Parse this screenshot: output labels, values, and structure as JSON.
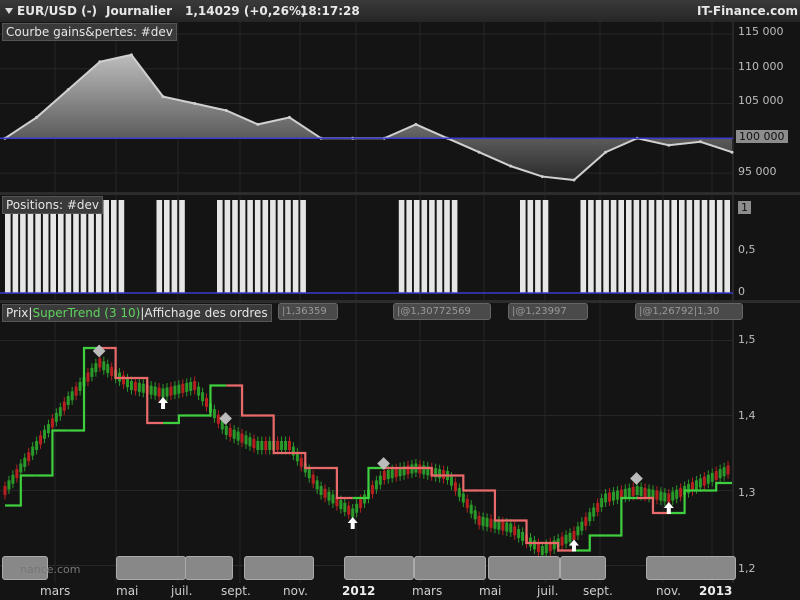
{
  "header": {
    "symbol": "EUR/USD (-)",
    "period": "Journalier",
    "price": "1,14029 (+0,26%)",
    "time": "18:17:28",
    "brand": "IT-Finance.com"
  },
  "panel1": {
    "title": "Courbe gains&pertes: #dev",
    "y_labels": [
      "115 000",
      "110 000",
      "105 000",
      "100 000",
      "95 000"
    ]
  },
  "panel2": {
    "title": "Positions: #dev",
    "y_labels": [
      "1",
      "0,5",
      "0"
    ]
  },
  "panel3": {
    "title_prefix": "Prix",
    "title_indicator": "SuperTrend (3 10)",
    "title_suffix": "Affichage des ordres",
    "order_tags": [
      "|1,36359",
      "|@1,30772569",
      "|@1,23997",
      "|@1,26792|1,30"
    ],
    "y_labels": [
      "1,5",
      "1,4",
      "1,3",
      "1,2"
    ],
    "watermark": "nance.com"
  },
  "x_axis": [
    "mars",
    "mai",
    "juil.",
    "sept.",
    "nov.",
    "2012",
    "mars",
    "mai",
    "juil.",
    "sept.",
    "nov.",
    "2013"
  ],
  "colors": {
    "equity_fill": "#9a9a9a",
    "equity_line": "#d0d0d0",
    "baseline": "#3a3ad0",
    "supertrend_up": "#3fcf3f",
    "supertrend_down": "#e86a6a",
    "candle_up": "#2a9a2a",
    "candle_down": "#b82020"
  },
  "chart_data": [
    {
      "type": "area",
      "title": "Courbe gains&pertes: #dev",
      "x": [
        "2011-02",
        "2011-03",
        "2011-04",
        "2011-05",
        "2011-06",
        "2011-07",
        "2011-08",
        "2011-09",
        "2011-10",
        "2011-11",
        "2011-12",
        "2012-01",
        "2012-02",
        "2012-03",
        "2012-04",
        "2012-05",
        "2012-06",
        "2012-07",
        "2012-08",
        "2012-09",
        "2012-10",
        "2012-11",
        "2012-12",
        "2013-01"
      ],
      "values": [
        100000,
        103000,
        107000,
        111000,
        112000,
        106000,
        105000,
        104000,
        102000,
        103000,
        100000,
        100000,
        100000,
        102000,
        100000,
        98000,
        96000,
        94500,
        94000,
        98000,
        100000,
        99000,
        99500,
        98000
      ],
      "ylim": [
        93000,
        116000
      ],
      "baseline": 100000
    },
    {
      "type": "bar",
      "title": "Positions: #dev",
      "x": [
        "2011-02",
        "2011-03",
        "2011-04",
        "2011-05",
        "2011-06",
        "2011-07",
        "2011-08",
        "2011-09",
        "2011-10",
        "2011-11",
        "2011-12",
        "2012-01",
        "2012-02",
        "2012-03",
        "2012-04",
        "2012-05",
        "2012-06",
        "2012-07",
        "2012-08",
        "2012-09",
        "2012-10",
        "2012-11",
        "2012-12",
        "2013-01"
      ],
      "values": [
        1,
        1,
        1,
        1,
        0,
        1,
        0,
        1,
        1,
        1,
        0,
        0,
        0,
        1,
        1,
        0,
        0,
        1,
        0,
        1,
        1,
        1,
        1,
        1
      ],
      "ylim": [
        0,
        1
      ]
    },
    {
      "type": "line",
      "title": "Prix",
      "series_name": "SuperTrend (3 10)",
      "x": [
        "2011-02",
        "2011-03",
        "2011-04",
        "2011-05",
        "2011-06",
        "2011-07",
        "2011-08",
        "2011-09",
        "2011-10",
        "2011-11",
        "2011-12",
        "2012-01",
        "2012-02",
        "2012-03",
        "2012-04",
        "2012-05",
        "2012-06",
        "2012-07",
        "2012-08",
        "2012-09",
        "2012-10",
        "2012-11",
        "2012-12",
        "2013-01"
      ],
      "price": [
        1.3,
        1.36,
        1.42,
        1.47,
        1.44,
        1.43,
        1.44,
        1.38,
        1.36,
        1.36,
        1.3,
        1.27,
        1.32,
        1.33,
        1.32,
        1.26,
        1.25,
        1.22,
        1.24,
        1.29,
        1.3,
        1.29,
        1.31,
        1.33
      ],
      "supertrend": [
        1.28,
        1.32,
        1.38,
        1.49,
        1.45,
        1.39,
        1.4,
        1.44,
        1.4,
        1.35,
        1.33,
        1.29,
        1.33,
        1.33,
        1.32,
        1.3,
        1.26,
        1.23,
        1.22,
        1.24,
        1.29,
        1.27,
        1.3,
        1.31
      ],
      "trend_up": [
        true,
        true,
        true,
        false,
        false,
        true,
        true,
        false,
        false,
        false,
        false,
        true,
        false,
        false,
        false,
        false,
        false,
        false,
        true,
        true,
        false,
        true,
        true,
        true
      ],
      "ylim": [
        1.19,
        1.51
      ]
    }
  ]
}
